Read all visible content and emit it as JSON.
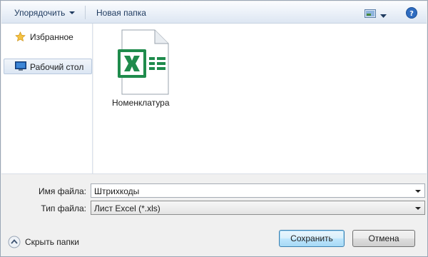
{
  "toolbar": {
    "organize_label": "Упорядочить",
    "new_folder_label": "Новая папка"
  },
  "nav": {
    "items": [
      {
        "label": "Избранное",
        "icon": "star-icon"
      },
      {
        "label": "Рабочий стол",
        "icon": "desktop-icon",
        "selected": true
      }
    ]
  },
  "files": [
    {
      "name": "Номенклатура",
      "icon": "excel-file-icon"
    }
  ],
  "form": {
    "filename_label": "Имя файла:",
    "filename_value": "Штрихкоды",
    "filetype_label": "Тип файла:",
    "filetype_value": "Лист Excel (*.xls)"
  },
  "footer": {
    "hide_folders_label": "Скрыть папки",
    "save_label": "Сохранить",
    "cancel_label": "Отмена"
  },
  "colors": {
    "excel_green": "#1f8b4c",
    "toolbar_text": "#1e3a5f",
    "help_blue": "#2f6cc0"
  }
}
